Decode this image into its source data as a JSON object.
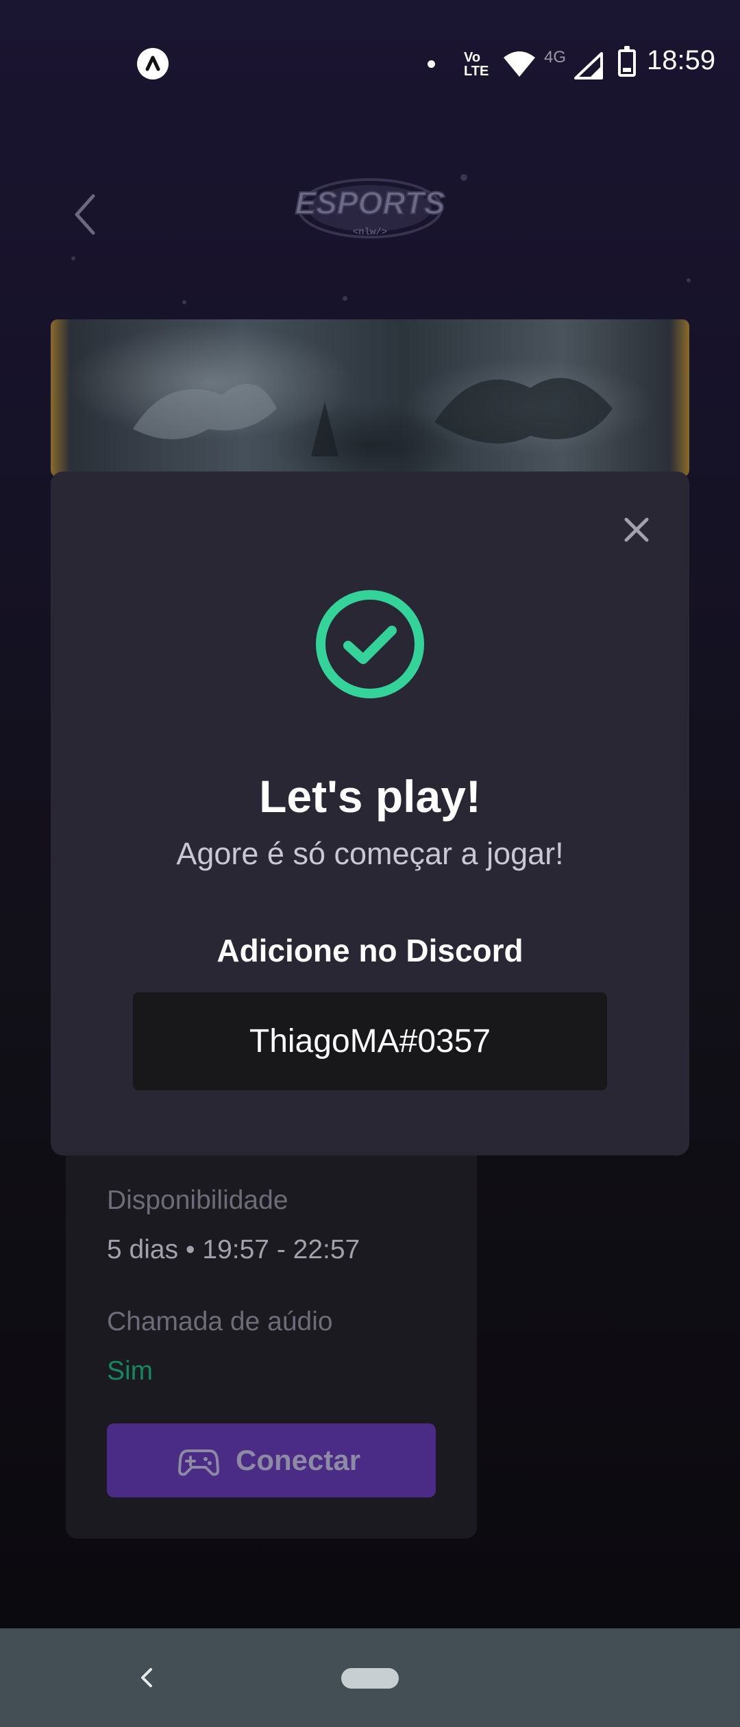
{
  "status_bar": {
    "time": "18:59",
    "network_label": "4G",
    "volte_top": "Vo",
    "volte_bottom": "LTE",
    "icons": [
      "app-icon",
      "notification-dot-icon",
      "volte-icon",
      "wifi-icon",
      "signal-icon",
      "battery-icon"
    ]
  },
  "header": {
    "logo_text": "ESPORTS",
    "logo_subtext": "<nlw/>",
    "back_icon": "chevron-left-icon"
  },
  "ad_card": {
    "availability_label": "Disponibilidade",
    "availability_value": "5 dias • 19:57 - 22:57",
    "voice_label": "Chamada de aúdio",
    "voice_value": "Sim",
    "connect_label": "Conectar",
    "connect_icon": "gamepad-icon"
  },
  "modal": {
    "close_icon": "close-icon",
    "success_icon": "check-circle-icon",
    "title": "Let's play!",
    "subtitle": "Agore é só começar a jogar!",
    "discord_label": "Adicione no Discord",
    "discord_value": "ThiagoMA#0357"
  },
  "colors": {
    "background": "#121018",
    "modal_bg": "#2a2734",
    "success": "#34d399",
    "accent": "#8b5cf6",
    "discord_box": "#18181b"
  }
}
